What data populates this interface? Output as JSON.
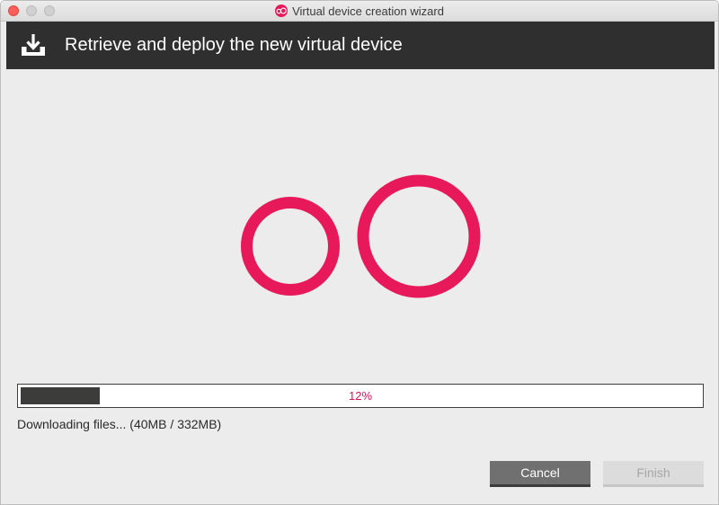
{
  "window": {
    "title": "Virtual device creation wizard"
  },
  "header": {
    "title": "Retrieve and deploy the new virtual device",
    "icon": "download-tray-icon"
  },
  "logo": {
    "icon": "genymotion-logo",
    "color": "#e8195a"
  },
  "progress": {
    "percent": 12,
    "label": "12%",
    "status": "Downloading files... (40MB / 332MB)"
  },
  "buttons": {
    "cancel_label": "Cancel",
    "finish_label": "Finish",
    "finish_enabled": false
  },
  "colors": {
    "header_bg": "#2f2f2f",
    "accent": "#e8195a",
    "progress_fill": "#3c3c3a"
  }
}
